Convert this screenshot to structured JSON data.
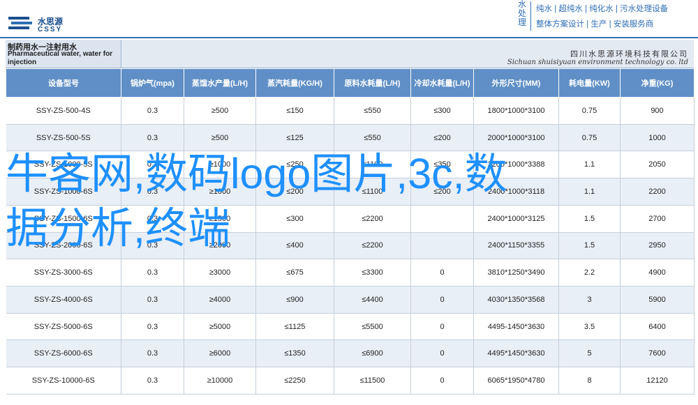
{
  "brand": {
    "name_cn": "水思源",
    "name_en": "CSSY"
  },
  "slogan": {
    "tag": "水处理",
    "line1": "纯水 | 超纯水 | 纯化水 | 污水处理设备",
    "line2": "整体方案设计 | 生产 | 安装服务商"
  },
  "title": {
    "cn": "制药用水一注射用水",
    "en": "Pharmaceutical water, water for injection"
  },
  "company": {
    "cn": "四川水思源环境科技有限公司",
    "en": "Sichuan shuisiyuan environment technology co. ltd"
  },
  "table": {
    "headers": [
      "设备型号",
      "锅炉气(mpa)",
      "蒸馏水产量(L/H)",
      "蒸汽耗量(KG/H)",
      "原料水耗量(L/H)",
      "冷却水耗量(L/H)",
      "外形尺寸(MM)",
      "耗电量(KW)",
      "净重(KG)"
    ],
    "rows": [
      [
        "SSY-ZS-500-4S",
        "0.3",
        "≥500",
        "≤150",
        "≤550",
        "≤300",
        "1800*1000*3100",
        "0.75",
        "900"
      ],
      [
        "SSY-ZS-500-5S",
        "0.3",
        "≥500",
        "≤125",
        "≤550",
        "≤200",
        "2000*1000*3100",
        "0.75",
        "1000"
      ],
      [
        "SSY-ZS-1000-5S",
        "0.3",
        "≥1000",
        "≤250",
        "≤1100",
        "≤350",
        "2200*1000*3388",
        "1.1",
        "2050"
      ],
      [
        "SSY-ZS-1000-6S",
        "0.3",
        "≥1000",
        "≤200",
        "≤1100",
        "≤200",
        "2400*1000*3118",
        "1.1",
        "2200"
      ],
      [
        "SSY-ZS-1500-6S",
        "0.3",
        "≥1500",
        "≤300",
        "≤2200",
        "",
        "2400*1000*3125",
        "1.5",
        "2700"
      ],
      [
        "SSY-ZS-2000-6S",
        "0.3",
        "≥2000",
        "≤400",
        "≤2200",
        "",
        "2400*1150*3355",
        "1.5",
        "2950"
      ],
      [
        "SSY-ZS-3000-6S",
        "0.3",
        "≥3000",
        "≤675",
        "≤3300",
        "0",
        "3810*1250*3490",
        "2.2",
        "4900"
      ],
      [
        "SSY-ZS-4000-6S",
        "0.3",
        "≥4000",
        "≤900",
        "≤4400",
        "0",
        "4030*1350*3568",
        "3",
        "5900"
      ],
      [
        "SSY-ZS-5000-6S",
        "0.3",
        "≥5000",
        "≤1125",
        "≤5500",
        "0",
        "4495-1450*3630",
        "3.5",
        "6400"
      ],
      [
        "SSY-ZS-6000-6S",
        "0.3",
        "≥6000",
        "≤1350",
        "≤6900",
        "0",
        "4495*1450*3630",
        "5",
        "7600"
      ],
      [
        "SSY-ZS-10000-6S",
        "0.3",
        "≥10000",
        "≤2250",
        "≤11500",
        "0",
        "6065*1950*4780",
        "8",
        "12120"
      ]
    ]
  },
  "watermark": {
    "text": "牛客网,数码logo图片,3c,数据分析,终端",
    "color": "#1e90ff"
  },
  "colors": {
    "header_bg": "#5f8fc6",
    "accent": "#2f6fb6",
    "row_alt": "#e9eff6"
  }
}
